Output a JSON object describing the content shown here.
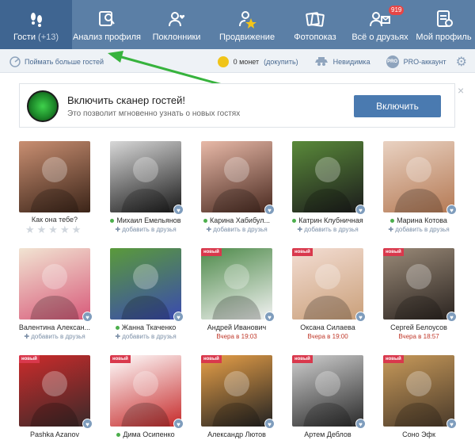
{
  "nav": {
    "items": [
      {
        "label": "Гости",
        "count": "(+13)",
        "icon": "footprints-icon",
        "active": true
      },
      {
        "label": "Анализ профиля",
        "icon": "profile-search-icon"
      },
      {
        "label": "Поклонники",
        "icon": "fans-icon"
      },
      {
        "label": "Продвижение",
        "icon": "promotion-icon"
      },
      {
        "label": "Фотопоказ",
        "icon": "photoshow-icon"
      },
      {
        "label": "Всё о друзьях",
        "icon": "friends-icon",
        "badge": "919"
      },
      {
        "label": "Мой профиль",
        "icon": "my-profile-icon"
      }
    ]
  },
  "subbar": {
    "catch_more": "Поймать больше гостей",
    "coins": "0 монет",
    "buy": "(докупить)",
    "invisible": "Невидимка",
    "pro_badge": "PRO",
    "pro": "PRO-аккаунт"
  },
  "banner": {
    "title": "Включить сканер гостей!",
    "subtitle": "Это позволит мгновенно узнать о новых гостях",
    "button": "Включить",
    "close": "×"
  },
  "labels": {
    "new": "новый",
    "add_friend": "добавить в друзья",
    "question": "Как она тебе?",
    "stars": "★★★★★",
    "heart": "♥"
  },
  "guests": [
    {
      "name": "",
      "question": true,
      "online": false,
      "new": false,
      "line2": "",
      "colors": [
        "#c98f72",
        "#3b2418"
      ]
    },
    {
      "name": "Михаил Емельянов",
      "online": true,
      "new": false,
      "line2": "add",
      "colors": [
        "#d8d8d8",
        "#1a1a1a"
      ]
    },
    {
      "name": "Карина Хабибул...",
      "online": true,
      "new": false,
      "line2": "add",
      "colors": [
        "#e8b9a8",
        "#4a2a20"
      ]
    },
    {
      "name": "Катрин Клубничная",
      "online": true,
      "new": false,
      "line2": "add",
      "colors": [
        "#5a8a3a",
        "#1c1c1c"
      ]
    },
    {
      "name": "Марина Котова",
      "online": true,
      "new": false,
      "line2": "add",
      "colors": [
        "#e9d2c2",
        "#b57a55"
      ]
    },
    {
      "name": "Валентина Алексан...",
      "online": false,
      "new": false,
      "line2": "add",
      "colors": [
        "#f1e4d2",
        "#d85a7a"
      ]
    },
    {
      "name": "Жанна Ткаченко",
      "online": true,
      "new": false,
      "line2": "add",
      "colors": [
        "#5a9a3a",
        "#3a4ab0"
      ]
    },
    {
      "name": "Андрей Иванович",
      "online": false,
      "new": true,
      "line2": "Вчера в 19:03",
      "colors": [
        "#4e8a4a",
        "#f2f2f2"
      ]
    },
    {
      "name": "Оксана Силаева",
      "online": false,
      "new": true,
      "line2": "Вчера в 19:00",
      "colors": [
        "#f3ddd3",
        "#caa07a"
      ]
    },
    {
      "name": "Сергей Белоусов",
      "online": false,
      "new": true,
      "line2": "Вчера в 18:57",
      "colors": [
        "#9a8a78",
        "#2b2420"
      ]
    },
    {
      "name": "Pashka Azanov",
      "online": false,
      "new": true,
      "line2": "",
      "colors": [
        "#cc2b2b",
        "#3a2a2a"
      ]
    },
    {
      "name": "Дима Осипенко",
      "online": true,
      "new": true,
      "line2": "",
      "colors": [
        "#ffffff",
        "#c62a2a"
      ]
    },
    {
      "name": "Александр Лютов",
      "online": false,
      "new": true,
      "line2": "",
      "colors": [
        "#e8a048",
        "#222222"
      ]
    },
    {
      "name": "Артем Деблов",
      "online": false,
      "new": true,
      "line2": "",
      "colors": [
        "#cfcfcf",
        "#2a2a2a"
      ]
    },
    {
      "name": "Соно Эфк",
      "online": false,
      "new": true,
      "line2": "",
      "colors": [
        "#c89a5a",
        "#4a3a2a"
      ]
    }
  ],
  "colors": {
    "nav_bg": "#5b7fa6",
    "nav_active": "#3f6591",
    "button": "#4a7ab0",
    "new_tag": "#d9384c",
    "arrow": "#37b33d"
  }
}
